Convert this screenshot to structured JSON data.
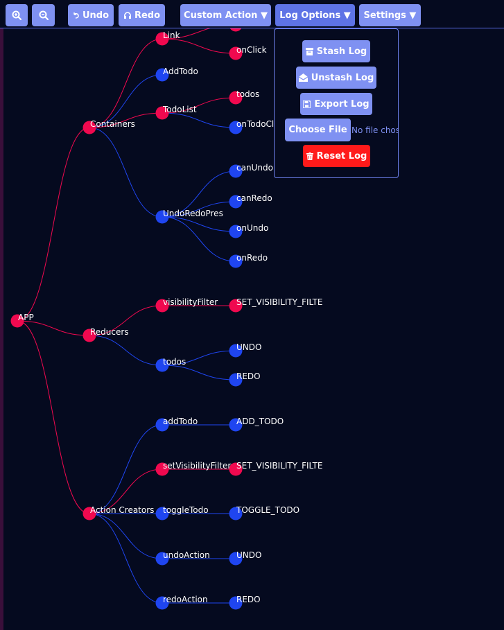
{
  "toolbar": {
    "zoom_in_icon": "zoom-in-icon",
    "zoom_out_icon": "zoom-out-icon",
    "undo_label": "Undo",
    "redo_label": "Redo",
    "custom_action_label": "Custom Action ▼",
    "log_options_label": "Log Options ▼",
    "settings_label": "Settings ▼"
  },
  "log_menu": {
    "stash_label": "Stash Log",
    "unstash_label": "Unstash Log",
    "export_label": "Export Log",
    "choose_file_label": "Choose File",
    "no_file_text": "No file chos",
    "reset_label": "Reset Log"
  },
  "colors": {
    "background": "#050a1f",
    "button": "#7f91f2",
    "danger": "#ff1a1a",
    "node_red": "#f0094f",
    "node_blue": "#1f45f0"
  },
  "tree": {
    "nodes": [
      {
        "id": "app",
        "label": "APP",
        "color": "red"
      },
      {
        "id": "containers",
        "label": "Containers",
        "color": "red",
        "parent": "app"
      },
      {
        "id": "reducers",
        "label": "Reducers",
        "color": "red",
        "parent": "app"
      },
      {
        "id": "actioncreators",
        "label": "Action Creators",
        "color": "red",
        "parent": "app"
      },
      {
        "id": "link",
        "label": "Link",
        "color": "red",
        "parent": "containers"
      },
      {
        "id": "addtodo",
        "label": "AddTodo",
        "color": "blue",
        "parent": "containers"
      },
      {
        "id": "todolist",
        "label": "TodoList",
        "color": "red",
        "parent": "containers"
      },
      {
        "id": "undoredopres",
        "label": "UndoRedoPres",
        "color": "blue",
        "parent": "containers"
      },
      {
        "id": "link_child0",
        "label": "",
        "color": "red",
        "parent": "link"
      },
      {
        "id": "onclick",
        "label": "onClick",
        "color": "red",
        "parent": "link"
      },
      {
        "id": "todos_c",
        "label": "todos",
        "color": "red",
        "parent": "todolist"
      },
      {
        "id": "ontodoclick",
        "label": "onTodoClick",
        "color": "blue",
        "parent": "todolist"
      },
      {
        "id": "canundo",
        "label": "canUndo",
        "color": "blue",
        "parent": "undoredopres"
      },
      {
        "id": "canredo",
        "label": "canRedo",
        "color": "blue",
        "parent": "undoredopres"
      },
      {
        "id": "onundo",
        "label": "onUndo",
        "color": "blue",
        "parent": "undoredopres"
      },
      {
        "id": "onredo",
        "label": "onRedo",
        "color": "blue",
        "parent": "undoredopres"
      },
      {
        "id": "visibilityfilter",
        "label": "visibilityFilter",
        "color": "red",
        "parent": "reducers"
      },
      {
        "id": "todos_r",
        "label": "todos",
        "color": "blue",
        "parent": "reducers"
      },
      {
        "id": "setvis_r",
        "label": "SET_VISIBILITY_FILTE",
        "color": "red",
        "parent": "visibilityfilter"
      },
      {
        "id": "undo_r",
        "label": "UNDO",
        "color": "blue",
        "parent": "todos_r"
      },
      {
        "id": "redo_r",
        "label": "REDO",
        "color": "blue",
        "parent": "todos_r"
      },
      {
        "id": "addtodo_a",
        "label": "addTodo",
        "color": "blue",
        "parent": "actioncreators"
      },
      {
        "id": "setvisibilityfilter",
        "label": "setVisibilityFilter",
        "color": "red",
        "parent": "actioncreators"
      },
      {
        "id": "toggletodo",
        "label": "toggleTodo",
        "color": "blue",
        "parent": "actioncreators"
      },
      {
        "id": "undoaction",
        "label": "undoAction",
        "color": "blue",
        "parent": "actioncreators"
      },
      {
        "id": "redoaction",
        "label": "redoAction",
        "color": "blue",
        "parent": "actioncreators"
      },
      {
        "id": "add_todo",
        "label": "ADD_TODO",
        "color": "blue",
        "parent": "addtodo_a"
      },
      {
        "id": "setvis_a",
        "label": "SET_VISIBILITY_FILTE",
        "color": "red",
        "parent": "setvisibilityfilter"
      },
      {
        "id": "toggle_todo",
        "label": "TOGGLE_TODO",
        "color": "blue",
        "parent": "toggletodo"
      },
      {
        "id": "undo_a",
        "label": "UNDO",
        "color": "blue",
        "parent": "undoaction"
      },
      {
        "id": "redo_a",
        "label": "REDO",
        "color": "blue",
        "parent": "redoaction"
      }
    ]
  }
}
